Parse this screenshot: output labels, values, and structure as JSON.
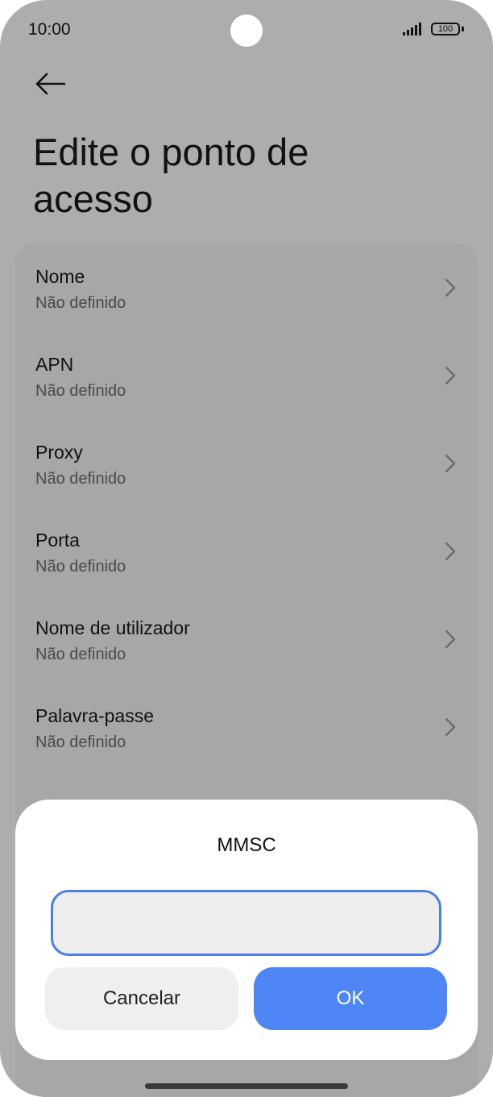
{
  "status_bar": {
    "time": "10:00",
    "battery": "100"
  },
  "header": {
    "title": "Edite o ponto de acesso"
  },
  "settings": {
    "items": [
      {
        "label": "Nome",
        "value": "Não definido"
      },
      {
        "label": "APN",
        "value": "Não definido"
      },
      {
        "label": "Proxy",
        "value": "Não definido"
      },
      {
        "label": "Porta",
        "value": "Não definido"
      },
      {
        "label": "Nome de utilizador",
        "value": "Não definido"
      },
      {
        "label": "Palavra-passe",
        "value": "Não definido"
      }
    ]
  },
  "dialog": {
    "title": "MMSC",
    "input_value": "",
    "cancel_label": "Cancelar",
    "ok_label": "OK"
  },
  "colors": {
    "background_dimmed": "#adadad",
    "accent": "#4e86f6",
    "input_border": "#4a7fe6"
  }
}
